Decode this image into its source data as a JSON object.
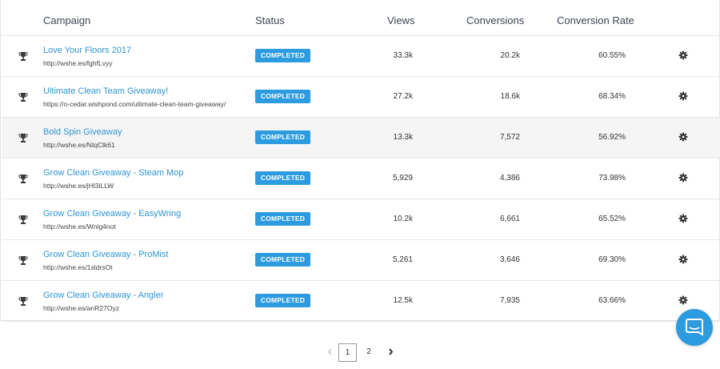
{
  "table": {
    "headers": {
      "campaign": "Campaign",
      "status": "Status",
      "views": "Views",
      "conversions": "Conversions",
      "conversion_rate": "Conversion Rate"
    },
    "rows": [
      {
        "name": "Love Your Floors 2017",
        "url": "http://wshe.es/fghfLvyy",
        "status": "COMPLETED",
        "views": "33.3k",
        "conversions": "20.2k",
        "rate": "60.55%"
      },
      {
        "name": "Ultimate Clean Team Giveaway!",
        "url": "https://o-cedar.wishpond.com/ultimate-clean-team-giveaway/",
        "status": "COMPLETED",
        "views": "27.2k",
        "conversions": "18.6k",
        "rate": "68.34%"
      },
      {
        "name": "Bold Spin Giveaway",
        "url": "http://wshe.es/NtqClk61",
        "status": "COMPLETED",
        "views": "13.3k",
        "conversions": "7,572",
        "rate": "56.92%"
      },
      {
        "name": "Grow Clean Giveaway - Steam Mop",
        "url": "http://wshe.es/jHl3iLLW",
        "status": "COMPLETED",
        "views": "5,929",
        "conversions": "4,386",
        "rate": "73.98%"
      },
      {
        "name": "Grow Clean Giveaway - EasyWring",
        "url": "http://wshe.es/Wnlg4not",
        "status": "COMPLETED",
        "views": "10.2k",
        "conversions": "6,661",
        "rate": "65.52%"
      },
      {
        "name": "Grow Clean Giveaway - ProMist",
        "url": "http://wshe.es/1sldrsOt",
        "status": "COMPLETED",
        "views": "5,261",
        "conversions": "3,646",
        "rate": "69.30%"
      },
      {
        "name": "Grow Clean Giveaway - Angler",
        "url": "http://wshe.es/anR27Oyz",
        "status": "COMPLETED",
        "views": "12.5k",
        "conversions": "7,935",
        "rate": "63.66%"
      }
    ]
  },
  "pagination": {
    "prev_icon": "chevron-left-icon",
    "pages": [
      "1",
      "2"
    ],
    "current_page": "1",
    "next_icon": "chevron-right-icon"
  },
  "colors": {
    "accent": "#2d9be0",
    "link": "#2f95d2"
  },
  "icons": {
    "row_icon": "trophy-icon",
    "row_action": "gear-icon",
    "chat": "chat-bubble-icon"
  }
}
